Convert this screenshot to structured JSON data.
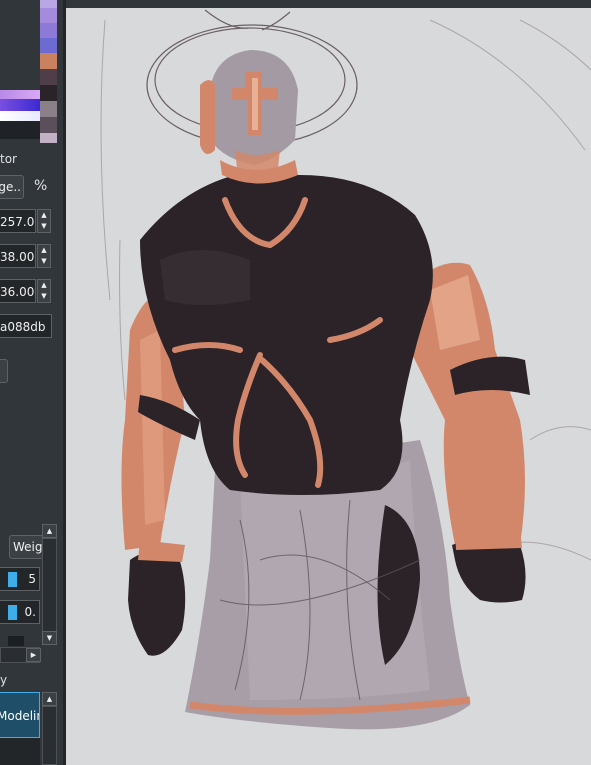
{
  "color_panel": {
    "selector_label": "tor",
    "mode_button_label": "ge..",
    "percent_label": "%",
    "swatches": [
      "#a48bdc",
      "#8d79d6",
      "#6d6bd2",
      "#c98160",
      "#4f3e48",
      "#2a2328",
      "#8a8088",
      "#5b4f5c",
      "#c2b0c4"
    ],
    "field_1": "257.00",
    "field_2": "38.00",
    "field_3": "36.00",
    "hex_value": "a088db"
  },
  "brush_panel": {
    "blend_button_label": "Weig",
    "opacity_value": "5",
    "flow_value": "0."
  },
  "layer_panel": {
    "header_label": "y",
    "selected_layer": "Modelin"
  },
  "canvas": {
    "title": "",
    "colors": {
      "skin": "#d2876a",
      "shirt": "#2b2327",
      "cloth": "#a69da6",
      "bg": "#d7d9da"
    }
  }
}
